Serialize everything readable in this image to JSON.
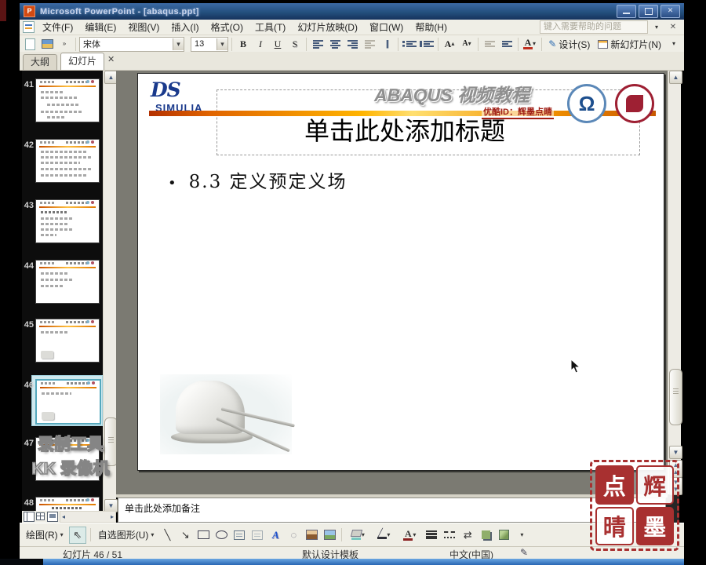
{
  "window": {
    "title": "Microsoft PowerPoint - [abaqus.ppt]"
  },
  "menu": {
    "items": [
      "文件(F)",
      "编辑(E)",
      "视图(V)",
      "插入(I)",
      "格式(O)",
      "工具(T)",
      "幻灯片放映(D)",
      "窗口(W)",
      "帮助(H)"
    ],
    "help_placeholder": "键入需要帮助的问题"
  },
  "toolbar": {
    "font_name": "宋体",
    "font_size": "13",
    "bold": "B",
    "italic": "I",
    "underline": "U",
    "shadow": "S",
    "font_grow": "A",
    "font_shrink": "A",
    "font_color": "A",
    "design": "设计(S)",
    "new_slide": "新幻灯片(N)"
  },
  "sidebar": {
    "tabs": [
      "大纲",
      "幻灯片"
    ],
    "thumbnails": [
      "41",
      "42",
      "43",
      "44",
      "45",
      "46",
      "47",
      "48"
    ],
    "selected": "46"
  },
  "slide": {
    "brand_mark": "DS",
    "brand_name": "SIMULIA",
    "header_title": "ABAQUS 视频教程",
    "youku_id": "优酷ID：辉墨点睛",
    "title_placeholder": "单击此处添加标题",
    "bullet_glyph": "•",
    "bullet_text": "8.3 定义预定义场"
  },
  "notes": {
    "placeholder": "单击此处添加备注"
  },
  "drawing": {
    "draw": "绘图(R)",
    "autoshapes": "自选图形(U)",
    "wordart": "A"
  },
  "status": {
    "slide": "幻灯片 46 / 51",
    "template": "默认设计模板",
    "language": "中文(中国)"
  },
  "watermark": {
    "line1": "录制工具",
    "line2": "KK 录像机"
  },
  "stamp": {
    "top_left": "点",
    "top_right": "辉",
    "bottom_left": "晴",
    "bottom_right": "墨"
  },
  "icons": {
    "dropdown": "▾",
    "caret_up": "▴",
    "close": "✕",
    "chevron": "»",
    "line": "╲",
    "arrow": "↘",
    "swap": "⇄",
    "pencil": "✎",
    "pointer": "⇖",
    "scroll_up": "▲",
    "scroll_down": "▼",
    "left": "◂",
    "right": "▸",
    "pp_letter": "P",
    "omega": "Ω"
  }
}
